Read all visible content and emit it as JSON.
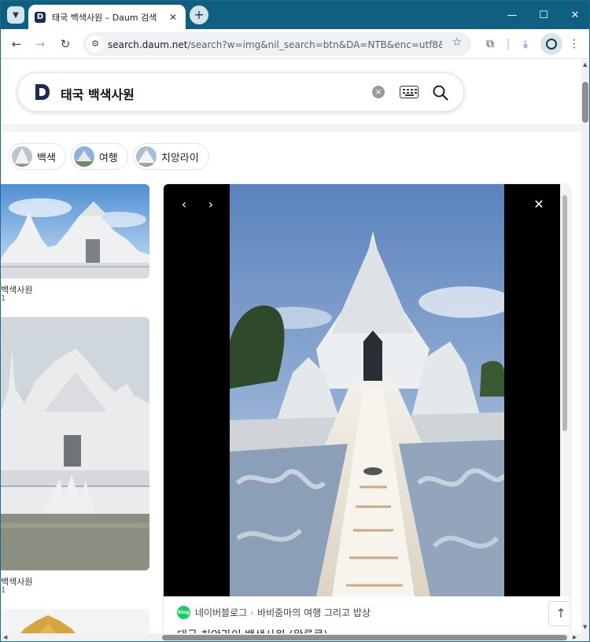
{
  "browser": {
    "tab_title": "태국 백색사원 – Daum 검색",
    "favicon_letter": "D",
    "url_host": "search.daum.net",
    "url_path": "/search?w=img&nil_search=btn&DA=NTB&enc=utf8&q=태...",
    "colors": {
      "tabstrip": "#0f5f80",
      "accent": "#1e2a55"
    }
  },
  "search": {
    "query": "태국 백색사원",
    "clear_label": "×"
  },
  "chips": [
    {
      "label": "백색"
    },
    {
      "label": "여행"
    },
    {
      "label": "치앙라이"
    }
  ],
  "results": [
    {
      "caption": "백색사원",
      "sub": "1"
    },
    {
      "caption": "백색사원",
      "sub": "1"
    }
  ],
  "viewer": {
    "prev_label": "‹",
    "next_label": "›",
    "close_label": "✕",
    "source": "네이버블로그",
    "blog_name": "바비줌마의 여행 그리고 밥상",
    "badge": "blog",
    "description": "태국 치앙라이 백색사원 (왓롱쿤)",
    "top_label": "↑"
  }
}
